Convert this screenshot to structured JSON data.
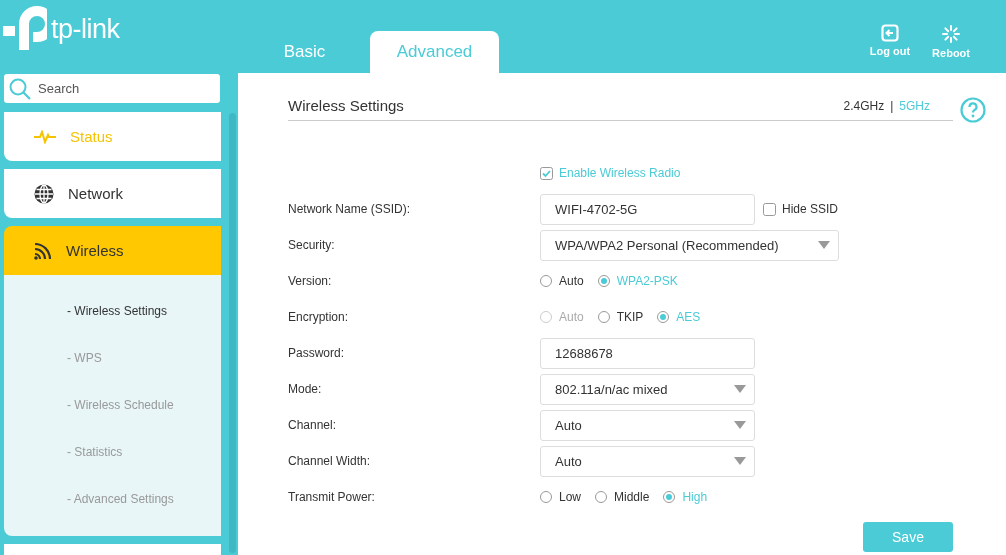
{
  "header": {
    "logo": "tp-link",
    "tabs": [
      {
        "label": "Basic",
        "selected": false
      },
      {
        "label": "Advanced",
        "selected": true
      }
    ],
    "actions": [
      {
        "kind": "logout",
        "label": "Log out"
      },
      {
        "kind": "reboot",
        "label": "Reboot"
      }
    ]
  },
  "sidebar": {
    "search": {
      "placeholder": "Search"
    },
    "items": [
      {
        "kind": "pulse",
        "label": "Status",
        "selected": false,
        "highlighted": true
      },
      {
        "kind": "globe",
        "label": "Network",
        "selected": false,
        "highlighted": false
      },
      {
        "kind": "wifi",
        "label": "Wireless",
        "selected": true,
        "highlighted": false,
        "expanded": true,
        "children": [
          {
            "label": "- Wireless Settings",
            "selected": true
          },
          {
            "label": "- WPS",
            "selected": false
          },
          {
            "label": "- Wireless Schedule",
            "selected": false
          },
          {
            "label": "- Statistics",
            "selected": false
          },
          {
            "label": "- Advanced Settings",
            "selected": false
          }
        ]
      }
    ]
  },
  "panel": {
    "title": "Wireless Settings",
    "bands": [
      {
        "label": "2.4GHz",
        "selected": false
      },
      {
        "label": "5GHz",
        "selected": true
      }
    ],
    "separator": "|",
    "rows": [
      {
        "kind": "checkbox",
        "text": "Enable Wireless Radio",
        "checked": true
      },
      {
        "kind": "text",
        "label": "Network Name (SSID):",
        "value": "WIFI-4702-5G",
        "extra": {
          "text": "Hide SSID",
          "checked": false
        }
      },
      {
        "kind": "select",
        "label": "Security:",
        "value": "WPA/WPA2 Personal (Recommended)",
        "wide": true
      },
      {
        "kind": "radio",
        "label": "Version:",
        "options": [
          {
            "label": "Auto",
            "selected": false,
            "disabled": false
          },
          {
            "label": "WPA2-PSK",
            "selected": true,
            "disabled": false
          }
        ]
      },
      {
        "kind": "radio",
        "label": "Encryption:",
        "options": [
          {
            "label": "Auto",
            "selected": false,
            "disabled": true
          },
          {
            "label": "TKIP",
            "selected": false,
            "disabled": false
          },
          {
            "label": "AES",
            "selected": true,
            "disabled": false
          }
        ]
      },
      {
        "kind": "text",
        "label": "Password:",
        "value": "12688678"
      },
      {
        "kind": "select",
        "label": "Mode:",
        "value": "802.11a/n/ac mixed",
        "wide": false
      },
      {
        "kind": "select",
        "label": "Channel:",
        "value": "Auto",
        "wide": false
      },
      {
        "kind": "select",
        "label": "Channel Width:",
        "value": "Auto",
        "wide": false
      },
      {
        "kind": "radio",
        "label": "Transmit Power:",
        "options": [
          {
            "label": "Low",
            "selected": false,
            "disabled": false
          },
          {
            "label": "Middle",
            "selected": false,
            "disabled": false
          },
          {
            "label": "High",
            "selected": true,
            "disabled": false
          }
        ]
      }
    ],
    "save": "Save"
  }
}
